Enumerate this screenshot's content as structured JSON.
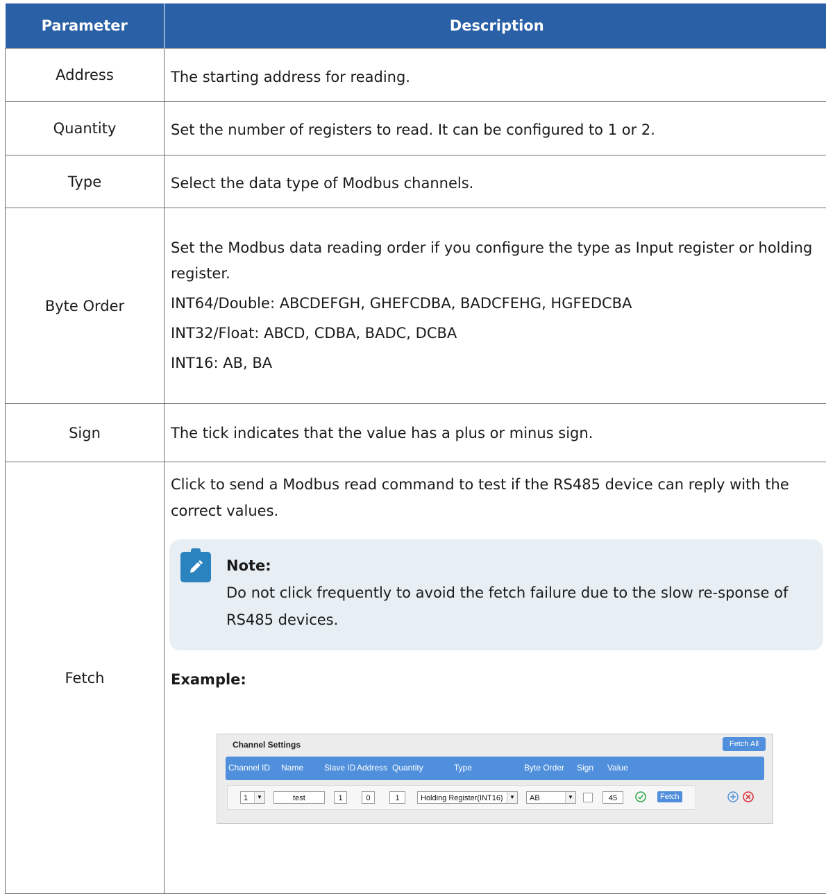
{
  "table": {
    "headers": {
      "param": "Parameter",
      "desc": "Description"
    },
    "rows": {
      "address": {
        "param": "Address",
        "desc": "The starting address for reading."
      },
      "quantity": {
        "param": "Quantity",
        "desc": "Set the number of registers to read. It can be configured to 1 or 2."
      },
      "type": {
        "param": "Type",
        "desc": "Select the data type of Modbus channels."
      },
      "byte_order": {
        "param": "Byte Order",
        "desc": "Set the Modbus data reading order if you configure the type as Input register or holding register.",
        "int64": "INT64/Double: ABCDEFGH, GHEFCDBA, BADCFEHG, HGFEDCBA",
        "int32": "INT32/Float: ABCD, CDBA, BADC, DCBA",
        "int16": "INT16: AB, BA"
      },
      "sign": {
        "param": "Sign",
        "desc": "The tick indicates that the value has a plus or minus sign."
      },
      "fetch": {
        "param": "Fetch",
        "desc": "Click to send a Modbus read command to test if the RS485 device can reply with the correct values.",
        "note_title": "Note:",
        "note_text": "Do not click frequently to avoid the fetch failure due to the slow re-sponse of RS485 devices.",
        "example_label": "Example:"
      }
    }
  },
  "screenshot": {
    "title": "Channel Settings",
    "fetch_all": "Fetch All",
    "columns": {
      "channel_id": "Channel ID",
      "name": "Name",
      "slave_id": "Slave ID",
      "address": "Address",
      "quantity": "Quantity",
      "type": "Type",
      "byte_order": "Byte Order",
      "sign": "Sign",
      "value": "Value"
    },
    "row": {
      "channel_id": "1",
      "name": "test",
      "slave_id": "1",
      "address": "0",
      "quantity": "1",
      "type": "Holding Register(INT16)",
      "byte_order": "AB",
      "sign_checked": false,
      "value": "45",
      "fetch": "Fetch"
    },
    "icons": [
      "ok-icon",
      "add-icon",
      "delete-icon",
      "note-pencil-icon"
    ],
    "colors": {
      "header": "#2a60a6",
      "accent": "#4f8fdc",
      "ok": "#2ea84a",
      "delete": "#d9303a",
      "note_bg": "#e7eff4"
    }
  }
}
